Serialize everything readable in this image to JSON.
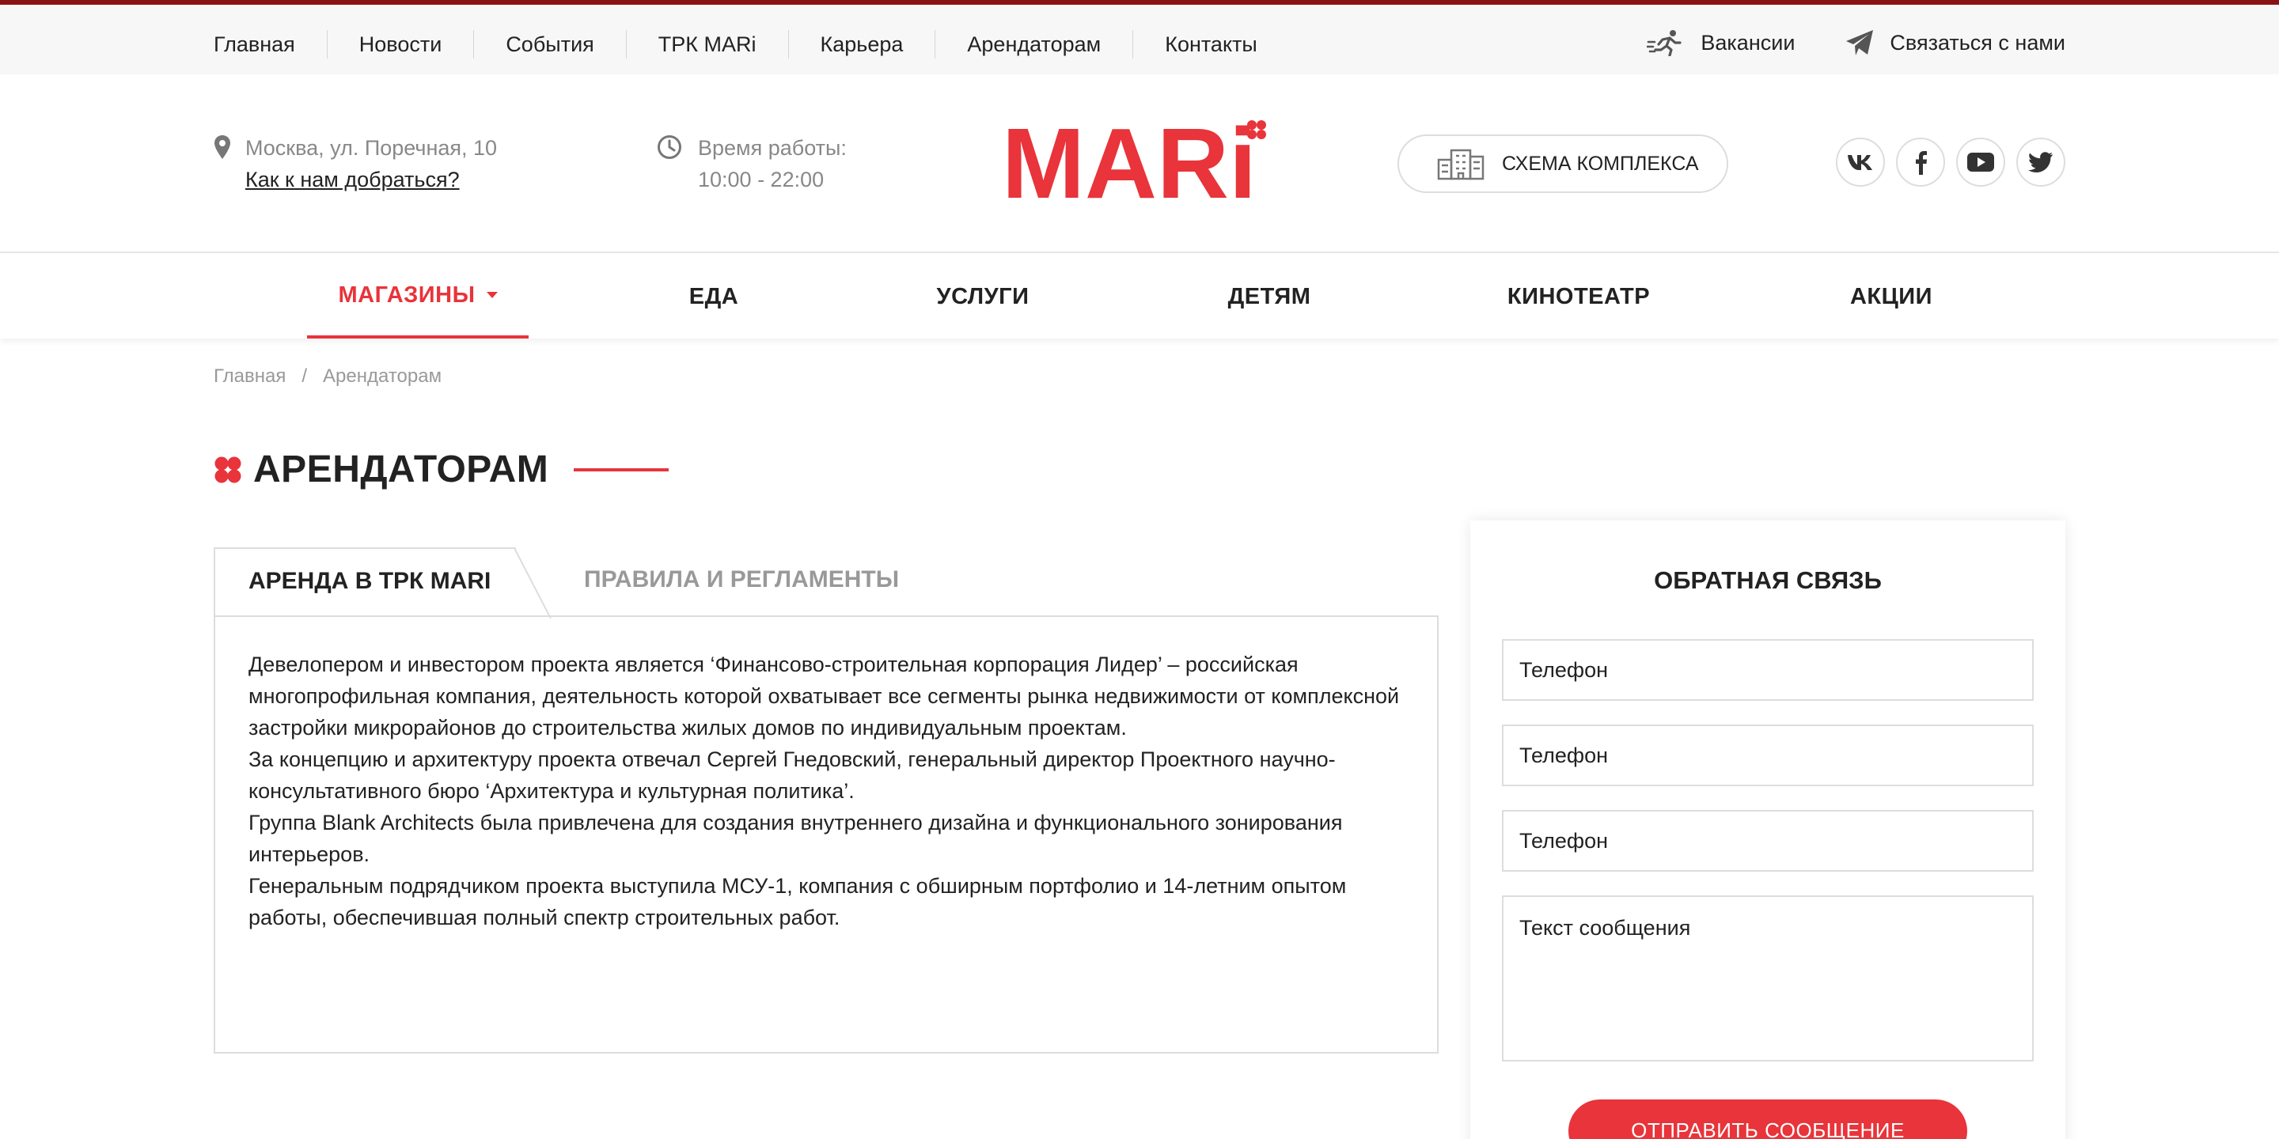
{
  "topnav": {
    "items": [
      "Главная",
      "Новости",
      "События",
      "ТРК MARi",
      "Карьера",
      "Арендаторам",
      "Контакты"
    ],
    "vacancies": "Вакансии",
    "contact": "Связаться с нами"
  },
  "header": {
    "address": "Москва, ул. Поречная, 10",
    "route_link": "Как к нам добраться?",
    "hours_label": "Время работы:",
    "hours_value": "10:00 - 22:00",
    "logo_text": "MARi",
    "scheme_button": "СХЕМА КОМПЛЕКСА",
    "socials": [
      "vk-icon",
      "facebook-icon",
      "youtube-icon",
      "twitter-icon"
    ]
  },
  "mainnav": {
    "items": [
      "МАГАЗИНЫ",
      "ЕДА",
      "УСЛУГИ",
      "ДЕТЯМ",
      "КИНОТЕАТР",
      "АКЦИИ"
    ],
    "active_index": 0
  },
  "breadcrumb": {
    "home": "Главная",
    "separator": "/",
    "current": "Арендаторам"
  },
  "page": {
    "title": "АРЕНДАТОРАМ"
  },
  "tabs": {
    "active": "АРЕНДА В ТРК MARI",
    "inactive": "ПРАВИЛА И РЕГЛАМЕНТЫ",
    "paragraphs": [
      "Девелопером и инвестором проекта является ‘Финансово-строительная корпорация Лидер’ – российская многопрофильная компания, деятельность которой охватывает все сегменты рынка недвижимости от комплексной застройки микрорайонов до строительства жилых домов по индивидуальным проектам.",
      "За концепцию и архитектуру проекта отвечал Сергей Гнедовский, генеральный директор Проектного научно-консультативного бюро ‘Архитектура и культурная политика’.",
      "Группа Blank Architects была привлечена для создания внутреннего дизайна и функционального зонирования интерьеров.",
      "Генеральным подрядчиком проекта выступила МСУ-1, компания с обширным портфолио и 14-летним опытом работы, обеспечившая полный спектр строительных работ."
    ]
  },
  "feedback": {
    "title": "ОБРАТНАЯ СВЯЗЬ",
    "fields": [
      "Телефон",
      "Телефон",
      "Телефон"
    ],
    "message_placeholder": "Текст сообщения",
    "submit": "ОТПРАВИТЬ СООБЩЕНИЕ"
  },
  "colors": {
    "accent": "#e8343a",
    "top_border": "#8b1214",
    "muted": "#888888"
  }
}
